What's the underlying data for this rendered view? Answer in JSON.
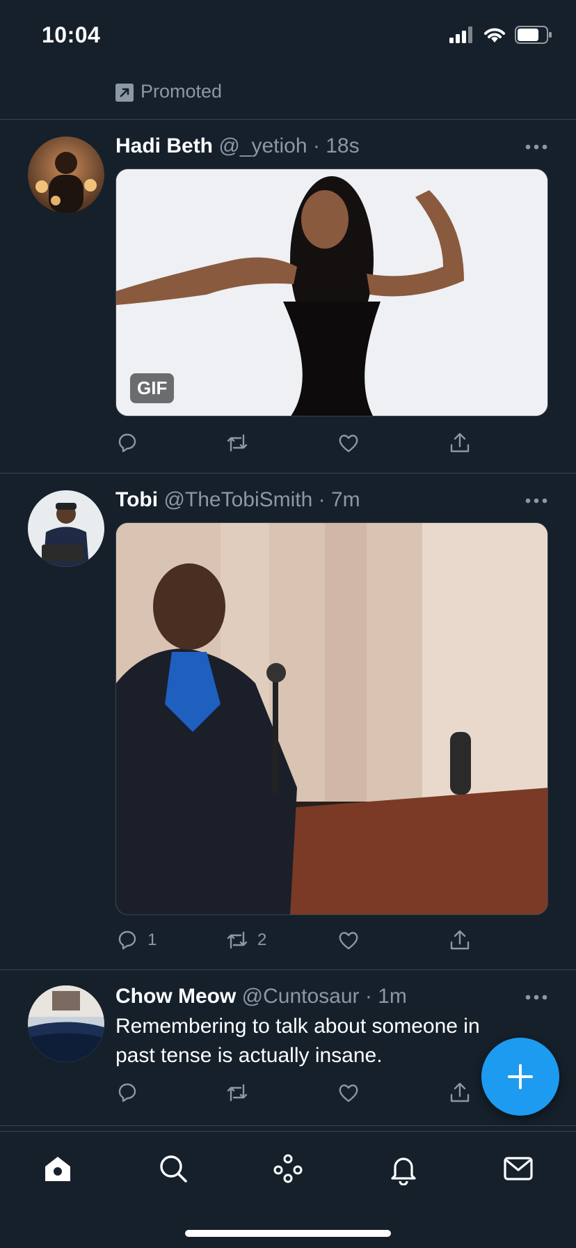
{
  "status_bar": {
    "time": "10:04",
    "battery_level": 0.75
  },
  "promoted": {
    "label": "Promoted"
  },
  "tweets": [
    {
      "name": "Hadi Beth",
      "handle": "@_yetioh",
      "separator": "·",
      "time": "18s",
      "text": "",
      "media_badge": "GIF",
      "replies": "",
      "retweets": "",
      "likes": ""
    },
    {
      "name": "Tobi",
      "handle": "@TheTobiSmith",
      "separator": "·",
      "time": "7m",
      "text": "",
      "media_badge": "",
      "replies": "1",
      "retweets": "2",
      "likes": ""
    },
    {
      "name": "Chow Meow",
      "handle": "@Cuntosaur",
      "separator": "·",
      "time": "1m",
      "text": "Remembering to talk about someone in past tense is actually insane.",
      "media_badge": "",
      "replies": "",
      "retweets": "",
      "likes": ""
    }
  ],
  "icons": {
    "reply": "reply-icon",
    "retweet": "retweet-icon",
    "like": "heart-icon",
    "share": "share-icon",
    "more": "more-icon",
    "compose": "plus-icon"
  },
  "tab_bar": {
    "items": [
      "home",
      "search",
      "spaces",
      "notifications",
      "messages"
    ],
    "active": "home"
  },
  "colors": {
    "background": "#15202b",
    "divider": "#38444d",
    "secondary_text": "#8b98a5",
    "accent": "#1d9bf0"
  }
}
